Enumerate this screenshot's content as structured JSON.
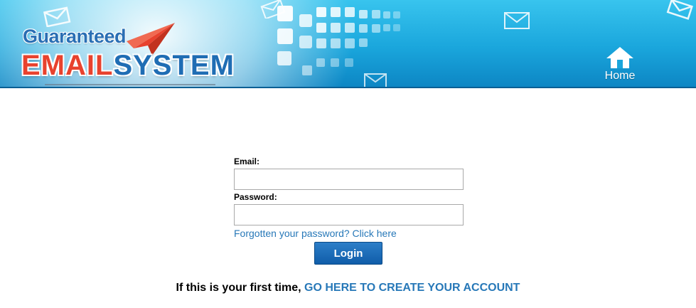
{
  "header": {
    "logo_top": "Guaranteed",
    "logo_red": "EMAIL",
    "logo_blue": "SYSTEM",
    "home_label": "Home",
    "colors": {
      "banner": "#1aa6dc",
      "logo_red": "#e8422e",
      "logo_blue": "#1f6db4"
    }
  },
  "login": {
    "email_label": "Email:",
    "email_value": "",
    "password_label": "Password:",
    "password_value": "",
    "forgot_text": "Forgotten your password? Click here",
    "login_label": "Login",
    "button_color": "#105da9"
  },
  "signup": {
    "prompt": "If this is your first time,",
    "link_text": "GO HERE TO CREATE YOUR ACCOUNT",
    "link_color": "#2778b8"
  }
}
